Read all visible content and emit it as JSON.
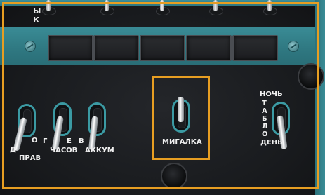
{
  "top_labels": {
    "yk_1": "Ы",
    "yk_2": "К"
  },
  "left_group": {
    "switch1_top_letter": "О",
    "switch1_side_letter": "Д",
    "switch1_label": "ПРАВ",
    "switch2_side_letter": "Г",
    "switch2_top_letter": "Е",
    "switch2_label": "ЧАСОВ",
    "switch3_side_letter": "В",
    "switch3_label": "АККУМ"
  },
  "center_switch": {
    "label": "МИГАЛКА",
    "state": "up"
  },
  "right_switch": {
    "top_label": "НОЧЬ",
    "vertical_letters": [
      "Т",
      "А",
      "Б",
      "Л",
      "О"
    ],
    "bottom_label": "ДЕНЬ",
    "state": "down"
  },
  "colors": {
    "highlight": "#e79e22",
    "panel_teal": "#3a8c96",
    "panel_dark": "#1b1d20"
  }
}
